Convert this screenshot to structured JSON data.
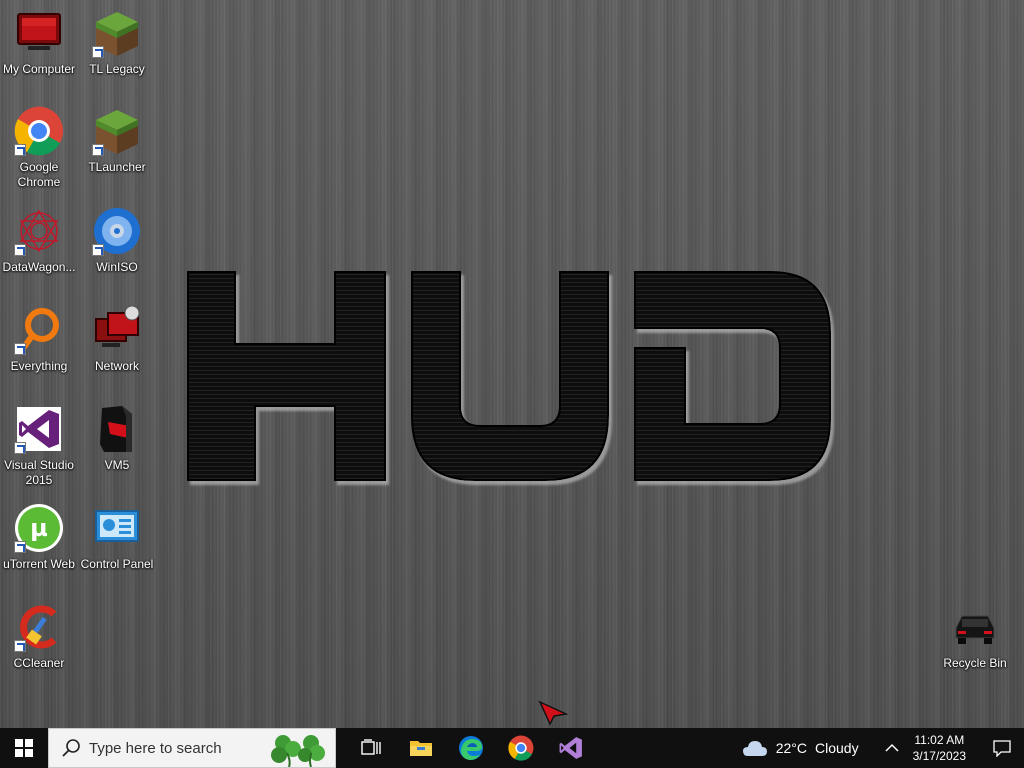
{
  "desktop": {
    "icons": [
      {
        "label": "My Computer"
      },
      {
        "label": "TL Legacy"
      },
      {
        "label": "Google Chrome"
      },
      {
        "label": "TLauncher"
      },
      {
        "label": "DataWagon..."
      },
      {
        "label": "WinISO"
      },
      {
        "label": "Everything"
      },
      {
        "label": "Network"
      },
      {
        "label": "Visual Studio 2015"
      },
      {
        "label": "VM5"
      },
      {
        "label": "uTorrent Web"
      },
      {
        "label": "Control Panel"
      },
      {
        "label": "CCleaner"
      },
      {
        "label": "Recycle Bin"
      }
    ],
    "wallpaper_logo": "HUD"
  },
  "taskbar": {
    "search_placeholder": "Type here to search",
    "pinned": [
      "task-view-icon",
      "file-explorer-icon",
      "edge-icon",
      "chrome-icon",
      "visual-studio-icon"
    ],
    "weather": {
      "temp": "22°C",
      "condition": "Cloudy"
    },
    "clock": {
      "time": "11:02 AM",
      "date": "3/17/2023"
    }
  },
  "colors": {
    "taskbar": "#101010",
    "accent": "#68217a"
  }
}
